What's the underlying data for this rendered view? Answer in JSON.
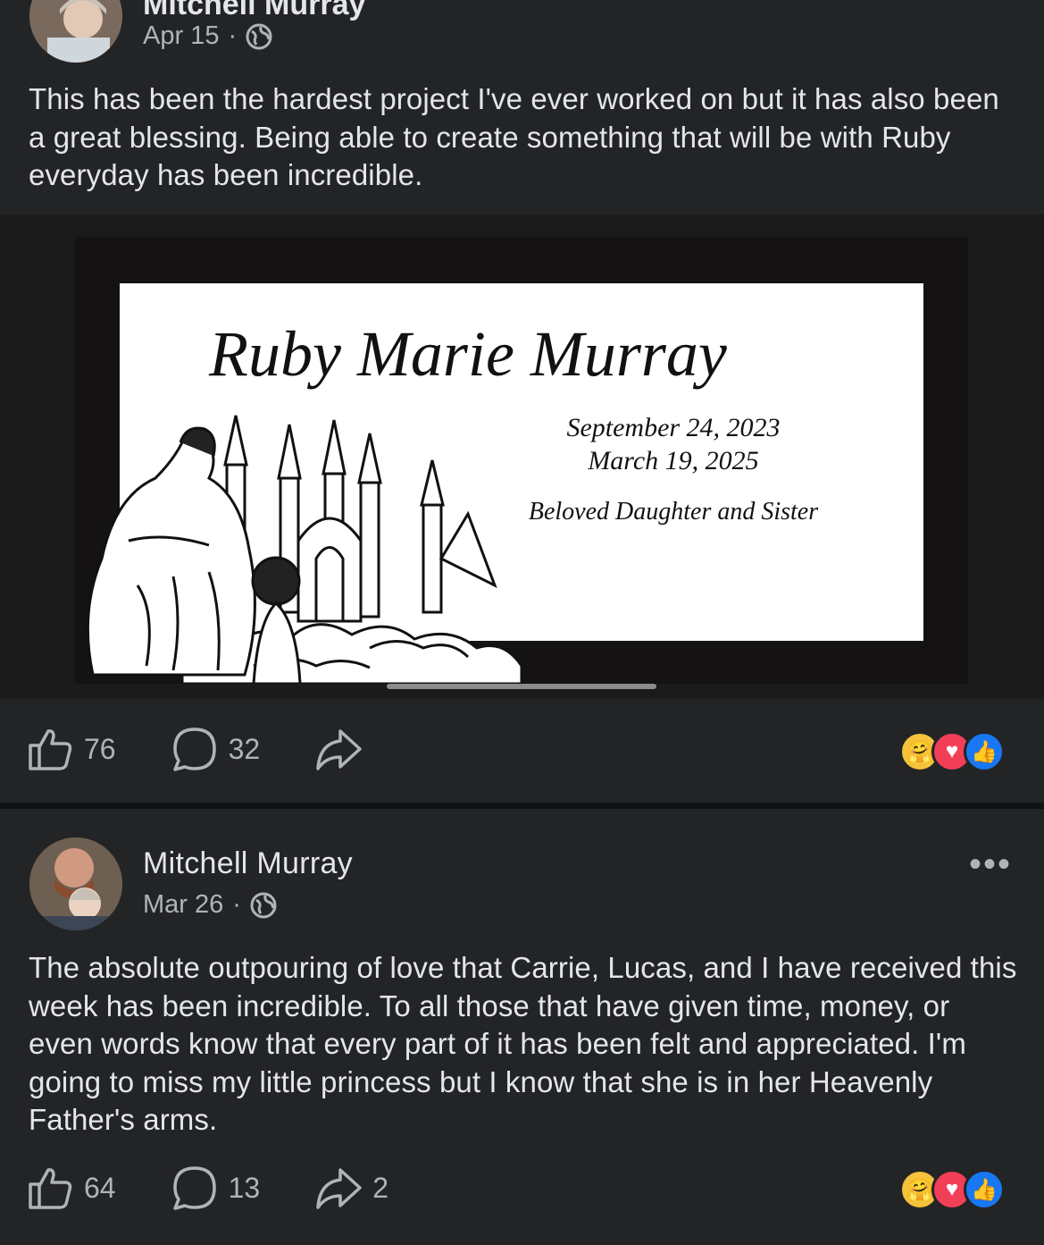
{
  "post1": {
    "author": "Mitchell Murray",
    "date": "Apr 15",
    "separator": "·",
    "text": "This has been the hardest project I've ever worked on but it has also been a great blessing. Being able to create something that will be with Ruby everyday has been incredible.",
    "image": {
      "name": "Ruby Marie Murray",
      "date_born": "September 24, 2023",
      "date_died": "March 19, 2025",
      "caption": "Beloved Daughter and Sister"
    },
    "likes": "76",
    "comments": "32",
    "shares": ""
  },
  "post2": {
    "author": "Mitchell Murray",
    "date": "Mar 26",
    "separator": "·",
    "more": "•••",
    "text": "The absolute outpouring of love that Carrie, Lucas, and I have received this week has been incredible. To all those that have given time, money, or even words know that every part of it has been felt and appreciated. I'm going to miss my little princess but I know that she is in her Heavenly Father's arms.",
    "likes": "64",
    "comments": "13",
    "shares": "2"
  },
  "reactions": [
    "care-icon",
    "love-icon",
    "like-icon"
  ],
  "colors": {
    "background": "#232426",
    "text": "#e4e6eb",
    "muted": "#b0b3b8",
    "like": "#1877f2",
    "love": "#f33e58",
    "care": "#f5c33b"
  }
}
